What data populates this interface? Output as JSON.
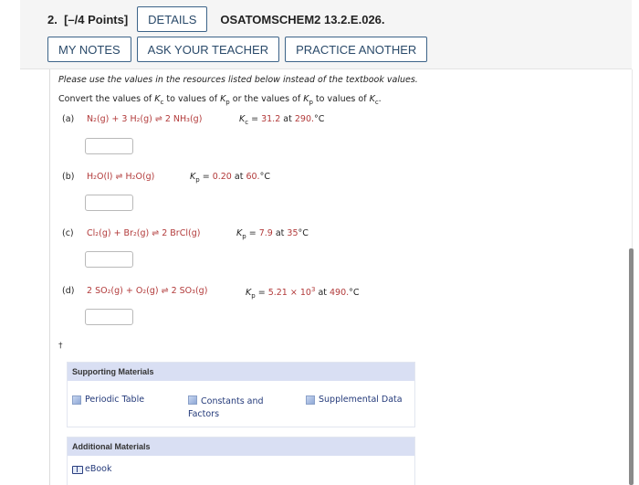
{
  "header": {
    "question_number": "2.",
    "points": "[–/4 Points]",
    "details_label": "DETAILS",
    "question_code": "OSATOMSCHEM2 13.2.E.026.",
    "my_notes_label": "MY NOTES",
    "ask_teacher_label": "ASK YOUR TEACHER",
    "practice_another_label": "PRACTICE ANOTHER"
  },
  "problem": {
    "instruction": "Please use the values in the resources listed below instead of the textbook values.",
    "convert_prefix": "Convert the values of ",
    "convert_mid1": " to values of ",
    "convert_mid2": " or the values of ",
    "convert_mid3": " to values of ",
    "convert_end": ".",
    "K": "K",
    "sub_c": "c",
    "sub_p": "p",
    "parts": [
      {
        "label": "(a)",
        "reaction": "N₂(g) + 3 H₂(g) ⇌ 2 NH₃(g)",
        "k_symbol": "K",
        "k_sub": "c",
        "k_value": "31.2",
        "at": "at",
        "temperature": "290.",
        "unit": "°C",
        "answer": ""
      },
      {
        "label": "(b)",
        "reaction": "H₂O(l) ⇌ H₂O(g)",
        "k_symbol": "K",
        "k_sub": "p",
        "k_value": "0.20",
        "at": "at",
        "temperature": "60.",
        "unit": "°C",
        "answer": ""
      },
      {
        "label": "(c)",
        "reaction": "Cl₂(g) + Br₂(g) ⇌ 2 BrCl(g)",
        "k_symbol": "K",
        "k_sub": "p",
        "k_value": "7.9",
        "at": "at",
        "temperature": "35",
        "unit": "°C",
        "answer": ""
      },
      {
        "label": "(d)",
        "reaction": "2 SO₂(g) + O₂(g) ⇌ 2 SO₃(g)",
        "k_symbol": "K",
        "k_sub": "p",
        "k_value": "5.21 × 10",
        "k_exp": "3",
        "at": "at",
        "temperature": "490.",
        "unit": "°C",
        "answer": ""
      }
    ],
    "dagger": "†"
  },
  "supporting_materials": {
    "title": "Supporting Materials",
    "items": [
      "Periodic Table",
      "Constants and Factors",
      "Supplemental Data"
    ]
  },
  "additional_materials": {
    "title": "Additional Materials",
    "items": [
      "eBook"
    ]
  },
  "colors": {
    "accent_border": "#3d6489",
    "value_red": "#b23a3a",
    "panel_header": "#d9dff3",
    "link_blue": "#243a7a"
  }
}
